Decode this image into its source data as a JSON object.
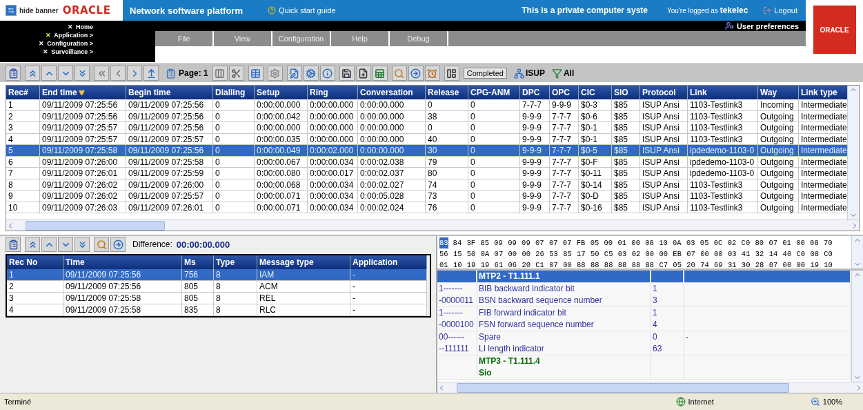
{
  "banner": {
    "hide_banner": "hide banner",
    "logo": "ORACLE",
    "title": "Network software platform",
    "quick_start": "Quick start guide",
    "notice": "This is a private computer syste",
    "logged_prefix": "You're logged as",
    "user": "tekelec",
    "logout": "Logout",
    "user_preferences": "User preferences",
    "brand_logo": "ORACLE"
  },
  "nav": [
    {
      "icon": "✕",
      "label": "Home",
      "highlighted": false
    },
    {
      "icon": "✕",
      "label": "Application >",
      "highlighted": true
    },
    {
      "icon": "✕",
      "label": "Configuration >",
      "highlighted": false
    },
    {
      "icon": "✕",
      "label": "Surveillance >",
      "highlighted": false
    }
  ],
  "menu": [
    "File",
    "View",
    "Configuration",
    "Help",
    "Debug"
  ],
  "toolbar": {
    "page": "Page: 1",
    "status": "Completed",
    "protocol": "ISUP",
    "filter": "All"
  },
  "records": {
    "columns": [
      {
        "label": "Rec#",
        "sorted": false
      },
      {
        "label": "End time",
        "sorted": true
      },
      {
        "label": "Begin time",
        "sorted": false
      },
      {
        "label": "Dialling",
        "sorted": false
      },
      {
        "label": "Setup",
        "sorted": false
      },
      {
        "label": "Ring",
        "sorted": false
      },
      {
        "label": "Conversation",
        "sorted": false
      },
      {
        "label": "Release",
        "sorted": false
      },
      {
        "label": "CPG-ANM",
        "sorted": false
      },
      {
        "label": "DPC",
        "sorted": false
      },
      {
        "label": "OPC",
        "sorted": false
      },
      {
        "label": "CIC",
        "sorted": false
      },
      {
        "label": "SIO",
        "sorted": false
      },
      {
        "label": "Protocol",
        "sorted": false
      },
      {
        "label": "Link",
        "sorted": false
      },
      {
        "label": "Way",
        "sorted": false
      },
      {
        "label": "Link type",
        "sorted": false
      }
    ],
    "rows": [
      {
        "selected": false,
        "cells": [
          "1",
          "09/11/2009 07:25:56",
          "09/11/2009 07:25:56",
          "0",
          "0:00:00.000",
          "0:00:00.000",
          "0:00:00.000",
          "0",
          "0",
          "7-7-7",
          "9-9-9",
          "$0-3",
          "$85",
          "ISUP Ansi",
          "1103-Testlink3",
          "Incoming",
          "Intermediate"
        ]
      },
      {
        "selected": false,
        "cells": [
          "2",
          "09/11/2009 07:25:56",
          "09/11/2009 07:25:56",
          "0",
          "0:00:00.042",
          "0:00:00.000",
          "0:00:00.000",
          "38",
          "0",
          "9-9-9",
          "7-7-7",
          "$0-6",
          "$85",
          "ISUP Ansi",
          "1103-Testlink3",
          "Outgoing",
          "Intermediate"
        ]
      },
      {
        "selected": false,
        "cells": [
          "3",
          "09/11/2009 07:25:57",
          "09/11/2009 07:25:56",
          "0",
          "0:00:00.000",
          "0:00:00.000",
          "0:00:00.000",
          "0",
          "0",
          "9-9-9",
          "7-7-7",
          "$0-1",
          "$85",
          "ISUP Ansi",
          "1103-Testlink3",
          "Outgoing",
          "Intermediate"
        ]
      },
      {
        "selected": false,
        "cells": [
          "4",
          "09/11/2009 07:25:57",
          "09/11/2009 07:25:57",
          "0",
          "0:00:00.035",
          "0:00:00.000",
          "0:00:00.000",
          "40",
          "0",
          "9-9-9",
          "7-7-7",
          "$0-1",
          "$85",
          "ISUP Ansi",
          "1103-Testlink3",
          "Outgoing",
          "Intermediate"
        ]
      },
      {
        "selected": true,
        "cells": [
          "5",
          "09/11/2009 07:25:58",
          "09/11/2009 07:25:56",
          "0",
          "0:00:00.049",
          "0:00:02.000",
          "0:00:00.000",
          "30",
          "0",
          "9-9-9",
          "7-7-7",
          "$0-5",
          "$85",
          "ISUP Ansi",
          "ipdedemo-1103-0",
          "Outgoing",
          "Intermediate"
        ]
      },
      {
        "selected": false,
        "cells": [
          "6",
          "09/11/2009 07:26:00",
          "09/11/2009 07:25:58",
          "0",
          "0:00:00.067",
          "0:00:00.034",
          "0:00:02.038",
          "79",
          "0",
          "9-9-9",
          "7-7-7",
          "$0-F",
          "$85",
          "ISUP Ansi",
          "ipdedemo-1103-0",
          "Outgoing",
          "Intermediate"
        ]
      },
      {
        "selected": false,
        "cells": [
          "7",
          "09/11/2009 07:26:01",
          "09/11/2009 07:25:59",
          "0",
          "0:00:00.080",
          "0:00:00.017",
          "0:00:02.037",
          "80",
          "0",
          "9-9-9",
          "7-7-7",
          "$0-11",
          "$85",
          "ISUP Ansi",
          "ipdedemo-1103-0",
          "Outgoing",
          "Intermediate"
        ]
      },
      {
        "selected": false,
        "cells": [
          "8",
          "09/11/2009 07:26:02",
          "09/11/2009 07:26:00",
          "0",
          "0:00:00.068",
          "0:00:00.034",
          "0:00:02.027",
          "74",
          "0",
          "9-9-9",
          "7-7-7",
          "$0-14",
          "$85",
          "ISUP Ansi",
          "1103-Testlink3",
          "Outgoing",
          "Intermediate"
        ]
      },
      {
        "selected": false,
        "cells": [
          "9",
          "09/11/2009 07:26:02",
          "09/11/2009 07:25:57",
          "0",
          "0:00:00.071",
          "0:00:00.034",
          "0:00:05.028",
          "73",
          "0",
          "9-9-9",
          "7-7-7",
          "$0-D",
          "$85",
          "ISUP Ansi",
          "1103-Testlink3",
          "Outgoing",
          "Intermediate"
        ]
      },
      {
        "selected": false,
        "cells": [
          "10",
          "09/11/2009 07:26:03",
          "09/11/2009 07:26:01",
          "0",
          "0:00:00.071",
          "0:00:00.034",
          "0:00:02.024",
          "76",
          "0",
          "9-9-9",
          "7-7-7",
          "$0-16",
          "$85",
          "ISUP Ansi",
          "1103-Testlink3",
          "Outgoing",
          "Intermediate"
        ]
      }
    ]
  },
  "messages": {
    "difference_label": "Difference:",
    "difference": "00:00:00.000",
    "columns": [
      "Rec No",
      "Time",
      "Ms",
      "Type",
      "Message type",
      "Application"
    ],
    "rows": [
      {
        "selected": true,
        "cells": [
          "1",
          "09/11/2009 07:25:56",
          "756",
          "8",
          "IAM",
          "-"
        ]
      },
      {
        "selected": false,
        "cells": [
          "2",
          "09/11/2009 07:25:56",
          "805",
          "8",
          "ACM",
          "-"
        ]
      },
      {
        "selected": false,
        "cells": [
          "3",
          "09/11/2009 07:25:58",
          "805",
          "8",
          "REL",
          "-"
        ]
      },
      {
        "selected": false,
        "cells": [
          "4",
          "09/11/2009 07:25:58",
          "835",
          "8",
          "RLC",
          "-"
        ]
      }
    ]
  },
  "hex": {
    "selected": "83",
    "lines": [
      "84 3F 85 09 09 09 07 07 07 FB 05 00 01 00 08 10 0A 03 05 0C 02 C0 80 07 01 00 08 70",
      "56 15 50 0A 07 00 00 26 53 85 17 50 C5 03 02 00 00 EB 07 00 00 03 41 32 14 40 C0 08 C0",
      "01 10 19 19 61 06 20 C1 07 00 88 88 88 88 88 88 C7 05 20 74 69 31 30 28 07 00 00 19 10"
    ]
  },
  "decode": [
    {
      "kind": "header",
      "selected": true,
      "name": "MTP2 - T1.111.1"
    },
    {
      "kind": "field",
      "selected": false,
      "bits": "1-------",
      "name": "BIB backward indicator bit",
      "value": "1"
    },
    {
      "kind": "field",
      "selected": false,
      "bits": "-0000011",
      "name": "BSN backward sequence number",
      "value": "3"
    },
    {
      "kind": "field",
      "selected": false,
      "bits": "1-------",
      "name": "FIB forward indicator bit",
      "value": "1"
    },
    {
      "kind": "field",
      "selected": false,
      "bits": "-0000100",
      "name": "FSN forward sequence number",
      "value": "4"
    },
    {
      "kind": "field",
      "selected": false,
      "bits": "00------",
      "name": "Spare",
      "value": "0",
      "extra": "-"
    },
    {
      "kind": "field",
      "selected": false,
      "bits": "--111111",
      "name": "LI length indicator",
      "value": "63"
    },
    {
      "kind": "section",
      "selected": false,
      "name": "MTP3 - T1.111.4"
    },
    {
      "kind": "section",
      "selected": false,
      "name": "Sio"
    }
  ],
  "status_bar": {
    "text": "Terminé",
    "zone": "Internet",
    "zoom": "100%"
  }
}
